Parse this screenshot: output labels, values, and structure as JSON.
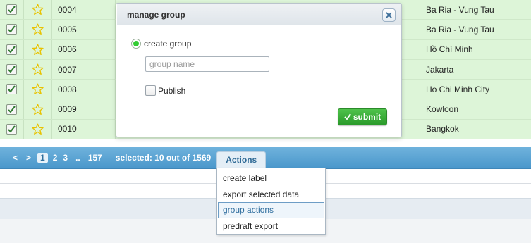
{
  "rows": [
    {
      "id": "0004",
      "city": "Ba Ria - Vung Tau",
      "checked": true
    },
    {
      "id": "0005",
      "city": "Ba Ria - Vung Tau",
      "checked": true
    },
    {
      "id": "0006",
      "city": "Hồ Chí Minh",
      "checked": true
    },
    {
      "id": "0007",
      "city": "Jakarta",
      "checked": true
    },
    {
      "id": "0008",
      "city": "Ho Chi Minh City",
      "checked": true
    },
    {
      "id": "0009",
      "city": "Kowloon",
      "checked": true
    },
    {
      "id": "0010",
      "city": "Bangkok",
      "checked": true
    }
  ],
  "pager": {
    "prev": "<",
    "next": ">",
    "pages": [
      "1",
      "2",
      "3"
    ],
    "current_page": "1",
    "ellipsis": "..",
    "last_page": "157",
    "selected_text": "selected: 10 out of 1569",
    "actions_label": "Actions"
  },
  "actions_menu": {
    "items": [
      "create label",
      "export selected data",
      "group actions",
      "predraft export"
    ],
    "highlighted": "group actions"
  },
  "modal": {
    "title": "manage group",
    "radio_label": "create group",
    "group_name_placeholder": "group name",
    "publish_label": "Publish",
    "submit_label": "submit"
  },
  "colors": {
    "row_bg": "#ddf5d8",
    "pager_bg": "#4a97cb",
    "submit_bg": "#33a532",
    "star": "#e8c200"
  }
}
